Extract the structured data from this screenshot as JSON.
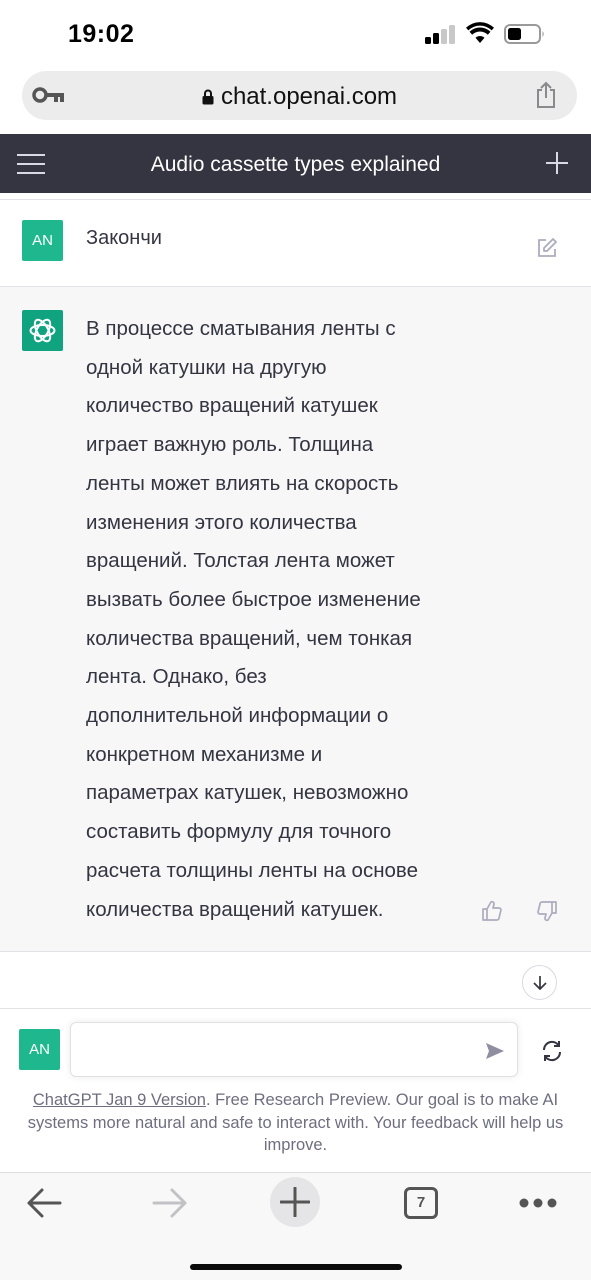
{
  "status_bar": {
    "time": "19:02",
    "icons": [
      "signal-icon",
      "wifi-icon",
      "battery-icon"
    ]
  },
  "browser": {
    "url": "chat.openai.com",
    "icons": [
      "key-icon",
      "lock-icon",
      "share-icon"
    ],
    "tabs_count": "7"
  },
  "header": {
    "title": "Audio cassette types explained",
    "icons": [
      "menu-icon",
      "plus-icon"
    ]
  },
  "conversation": {
    "user_initials": "AN",
    "user_message": "Закончи",
    "assistant_lines": [
      "В процессе сматывания ленты с",
      "одной катушки на другую",
      "количество вращений катушек",
      "играет важную роль. Толщина",
      "ленты может влиять на скорость",
      "изменения этого количества",
      "вращений. Толстая лента может",
      "вызвать более быстрое изменение",
      "количества вращений, чем тонкая",
      "лента. Однако, без",
      "дополнительной информации о",
      "конкретном механизме и",
      "параметрах катушек, невозможно",
      "составить формулу для точного",
      "расчета толщины ленты на основе",
      "количества вращений катушек."
    ]
  },
  "composer": {
    "user_initials": "AN",
    "input_value": "",
    "footer_link": "ChatGPT Jan 9 Version",
    "footer_text": ". Free Research Preview. Our goal is to make AI systems more natural and safe to interact with. Your feedback will help us improve."
  },
  "colors": {
    "header_bg": "#343541",
    "avatar_user": "#1fb78d",
    "avatar_assistant": "#10a37f",
    "assistant_bg": "#f7f7f8"
  }
}
